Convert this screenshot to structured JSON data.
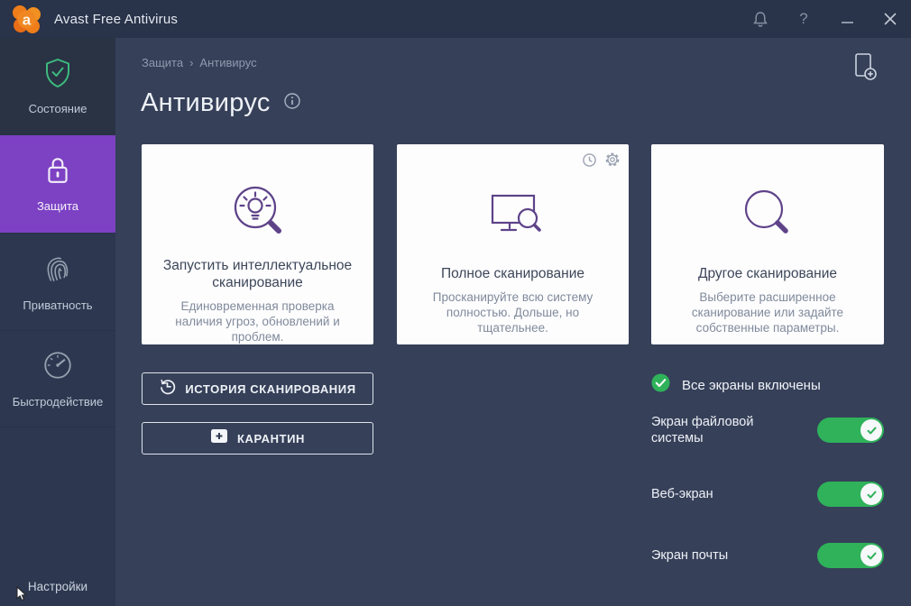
{
  "window": {
    "title": "Avast Free Antivirus",
    "help_glyph": "?"
  },
  "sidebar": {
    "items": [
      {
        "label": "Состояние"
      },
      {
        "label": "Защита"
      },
      {
        "label": "Приватность"
      },
      {
        "label": "Быстродействие"
      }
    ],
    "settings_label": "Настройки"
  },
  "breadcrumb": {
    "parent": "Защита",
    "separator": "›",
    "current": "Антивирус"
  },
  "page": {
    "title": "Антивирус"
  },
  "cards": [
    {
      "title": "Запустить интеллектуальное сканирование",
      "description": "Единовременная проверка наличия угроз, обновлений и проблем.",
      "icon": "smart-scan-icon"
    },
    {
      "title": "Полное сканирование",
      "description": "Просканируйте всю систему полностью. Дольше, но тщательнее.",
      "icon": "full-scan-icon"
    },
    {
      "title": "Другое сканирование",
      "description": "Выберите расширенное сканирование или задайте собственные параметры.",
      "icon": "other-scan-icon"
    }
  ],
  "actions": [
    {
      "label": "ИСТОРИЯ СКАНИРОВАНИЯ",
      "icon": "history-icon"
    },
    {
      "label": "КАРАНТИН",
      "icon": "quarantine-icon"
    }
  ],
  "shields": {
    "status_label": "Все экраны включены",
    "toggles": [
      {
        "label": "Экран файловой системы",
        "enabled": true
      },
      {
        "label": "Веб-экран",
        "enabled": true
      },
      {
        "label": "Экран почты",
        "enabled": true
      }
    ]
  },
  "colors": {
    "accent_purple": "#7c42c3",
    "icon_purple": "#5e4389",
    "success_green": "#2fb25a",
    "titlebar": "#293349",
    "content_bg": "#364059",
    "card_bg": "#fdfdfe"
  }
}
